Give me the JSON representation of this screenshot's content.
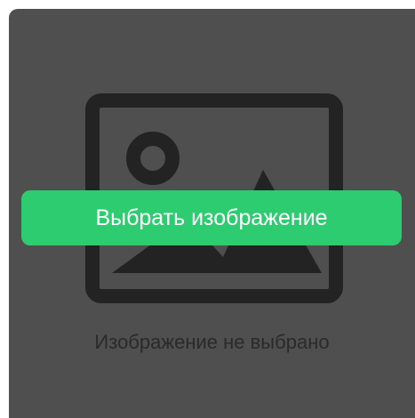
{
  "image_picker": {
    "choose_button_label": "Выбрать изображение",
    "empty_state_text": "Изображение не выбрано",
    "placeholder_icon": "image-icon"
  },
  "colors": {
    "panel_background": "#4f4f4f",
    "icon_color": "#232323",
    "button_background": "#2ecc71",
    "button_text": "#ffffff",
    "empty_text": "#2a2a2a"
  }
}
